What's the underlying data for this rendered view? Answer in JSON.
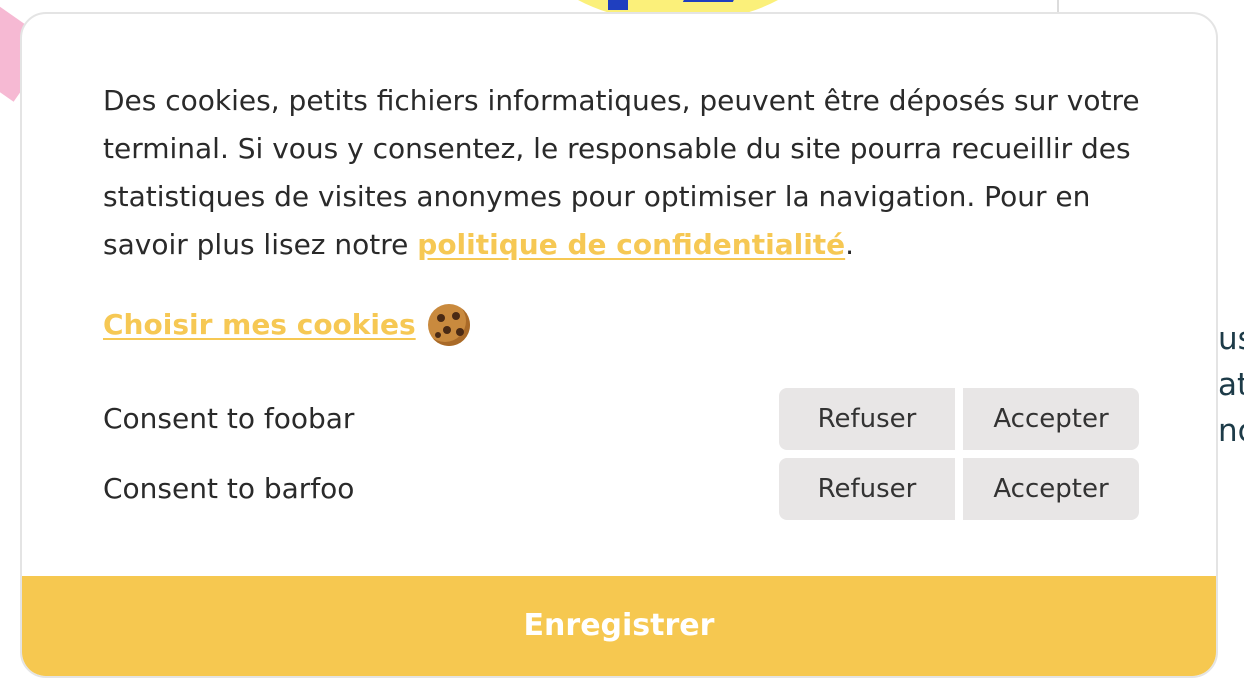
{
  "background": {
    "side_text_lines": [
      "us",
      "at",
      "nc"
    ]
  },
  "modal": {
    "intro_text": "Des cookies, petits fichiers informatiques, peuvent être déposés sur votre terminal. Si vous y consentez, le responsable du site pourra recueillir des statistiques de visites anonymes pour optimiser la navigation. Pour en savoir plus lisez notre ",
    "privacy_link_label": "politique de confidentialité",
    "intro_end": ".",
    "choose_label": "Choisir mes cookies",
    "choose_icon": "cookie-icon",
    "consents": [
      {
        "label": "Consent to foobar",
        "refuse_label": "Refuser",
        "accept_label": "Accepter"
      },
      {
        "label": "Consent to barfoo",
        "refuse_label": "Refuser",
        "accept_label": "Accepter"
      }
    ],
    "save_label": "Enregistrer"
  },
  "colors": {
    "accent": "#f6c850",
    "link": "#f6c854",
    "button_bg": "#e8e6e6",
    "text": "#2a2a2a"
  }
}
